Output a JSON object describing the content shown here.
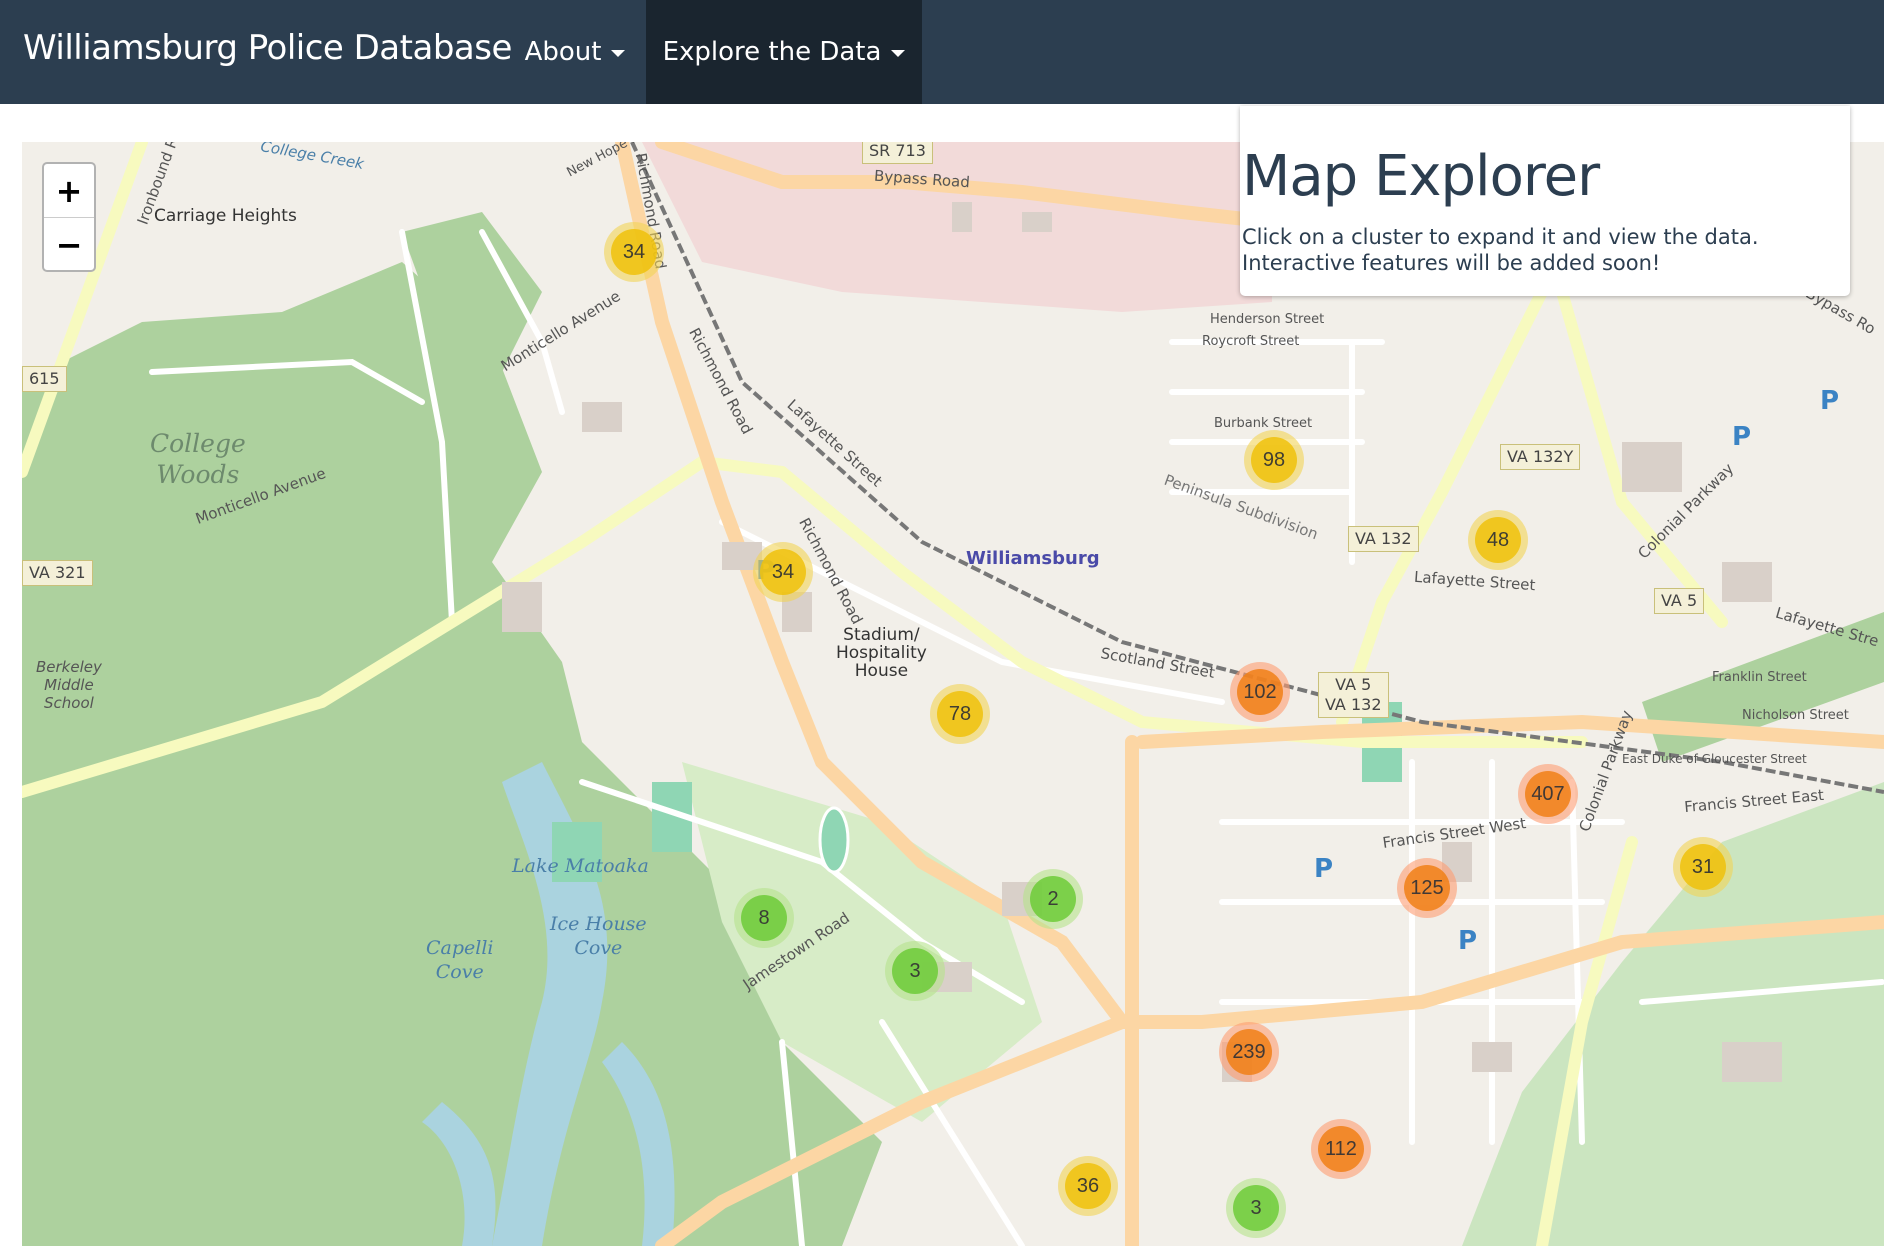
{
  "navbar": {
    "brand": "Williamsburg Police Database",
    "about_label": "About",
    "explore_label": "Explore the Data"
  },
  "map": {
    "zoom_in": "+",
    "zoom_out": "−",
    "labels": {
      "college_woods": "College\nWoods",
      "lake_matoaka": "Lake Matoaka",
      "ice_house_cove": "Ice House\nCove",
      "capelli_cove": "Capelli\nCove",
      "berkeley": "Berkeley\nMiddle\nSchool",
      "williamsburg": "Williamsburg",
      "stadium": "Stadium/\nHospitality\nHouse",
      "carriage_heights": "Carriage Heights",
      "bypass_road": "Bypass Road",
      "bypass_road_2": "Bypass Ro",
      "monticello_1": "Monticello Avenue",
      "monticello_2": "Monticello Avenue",
      "richmond_1": "Richmond Road",
      "richmond_2": "Richmond Road",
      "richmond_3": "Richmond Road",
      "lafayette_1": "Lafayette Street",
      "lafayette_2": "Lafayette Street",
      "lafayette_3": "Lafayette Stre",
      "francis_west": "Francis Street West",
      "francis_east": "Francis Street East",
      "jamestown": "Jamestown Road",
      "colonial_1": "Colonial Parkway",
      "colonial_2": "Colonial Parkway",
      "henderson": "Henderson Street",
      "roycroft": "Roycroft Street",
      "burbank": "Burbank Street",
      "franklin": "Franklin Street",
      "nicholson": "Nicholson Street",
      "duke": "East Duke of Gloucester Street",
      "peninsula": "Peninsula Subdivision",
      "new_hope": "New Hope Road",
      "ironbound": "Ironbound R",
      "scotland": "Scotland Street",
      "college_creek": "College Creek"
    },
    "shields": {
      "va132y": "VA 132Y",
      "va132": "VA 132",
      "va5": "VA 5",
      "va5_132": "VA 5\nVA 132",
      "va321": "VA 321",
      "sr713": "SR 713",
      "r615": "615"
    },
    "clusters": [
      {
        "count": "34",
        "level": "medium"
      },
      {
        "count": "34",
        "level": "medium"
      },
      {
        "count": "98",
        "level": "medium"
      },
      {
        "count": "48",
        "level": "medium"
      },
      {
        "count": "78",
        "level": "medium"
      },
      {
        "count": "102",
        "level": "large"
      },
      {
        "count": "407",
        "level": "large"
      },
      {
        "count": "125",
        "level": "large"
      },
      {
        "count": "31",
        "level": "medium"
      },
      {
        "count": "8",
        "level": "small"
      },
      {
        "count": "2",
        "level": "small"
      },
      {
        "count": "3",
        "level": "small"
      },
      {
        "count": "239",
        "level": "large"
      },
      {
        "count": "112",
        "level": "large"
      },
      {
        "count": "36",
        "level": "medium"
      },
      {
        "count": "3",
        "level": "small"
      }
    ]
  },
  "info": {
    "title": "Map Explorer",
    "text": "Click on a cluster to expand it and view the data. Interactive features will be added soon!"
  },
  "colors": {
    "navbar": "#2c3e50",
    "navbar_active": "#1a252f",
    "cluster_small": "#6ecc39",
    "cluster_medium": "#f0c20c",
    "cluster_large": "#f18017"
  }
}
